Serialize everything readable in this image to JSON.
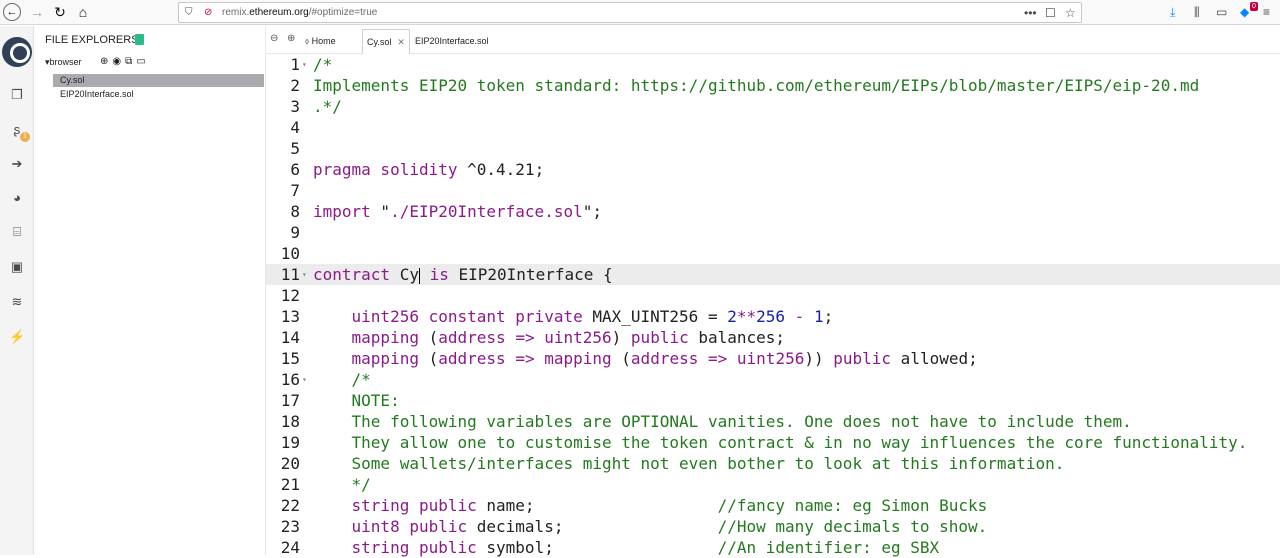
{
  "browser": {
    "url_prefix": "remix.",
    "url_domain": "ethereum.org",
    "url_suffix": "/#optimize=true",
    "menu_dots": "•••",
    "ext_badge": "0"
  },
  "file_explorer": {
    "title": "FILE EXPLORERS",
    "root": "browser",
    "files": [
      {
        "name": "Cy.sol",
        "active": true
      },
      {
        "name": "EIP20Interface.sol",
        "active": false
      }
    ]
  },
  "tabs": {
    "home": "Home",
    "items": [
      {
        "label": "Cy.sol",
        "active": true
      },
      {
        "label": "EIP20Interface.sol",
        "active": false
      }
    ]
  },
  "icon_panel": {
    "badge_count": "1"
  },
  "editor": {
    "highlighted_line": 11,
    "lines": [
      {
        "n": "1",
        "fold": true,
        "tokens": [
          [
            "comment",
            "/*"
          ]
        ]
      },
      {
        "n": "2",
        "fold": false,
        "tokens": [
          [
            "comment",
            "Implements EIP20 token standard: https://github.com/ethereum/EIPs/blob/master/EIPS/eip-20.md"
          ]
        ]
      },
      {
        "n": "3",
        "fold": false,
        "tokens": [
          [
            "comment",
            ".*/"
          ]
        ]
      },
      {
        "n": "4",
        "fold": false,
        "tokens": []
      },
      {
        "n": "5",
        "fold": false,
        "tokens": []
      },
      {
        "n": "6",
        "fold": false,
        "tokens": [
          [
            "kw",
            "pragma solidity"
          ],
          [
            "plain",
            " ^0.4.21;"
          ]
        ]
      },
      {
        "n": "7",
        "fold": false,
        "tokens": []
      },
      {
        "n": "8",
        "fold": false,
        "tokens": [
          [
            "kw",
            "import"
          ],
          [
            "plain",
            " \""
          ],
          [
            "kw",
            "./EIP20Interface.sol"
          ],
          [
            "plain",
            "\";"
          ]
        ]
      },
      {
        "n": "9",
        "fold": false,
        "tokens": []
      },
      {
        "n": "10",
        "fold": false,
        "tokens": []
      },
      {
        "n": "11",
        "fold": true,
        "tokens": [
          [
            "kw",
            "contract"
          ],
          [
            "plain",
            " Cy"
          ],
          [
            "cursor",
            ""
          ],
          [
            "plain",
            " "
          ],
          [
            "kw",
            "is"
          ],
          [
            "plain",
            " EIP20Interface {"
          ]
        ]
      },
      {
        "n": "12",
        "fold": false,
        "tokens": []
      },
      {
        "n": "13",
        "fold": false,
        "tokens": [
          [
            "plain",
            "    "
          ],
          [
            "kw",
            "uint256 constant private"
          ],
          [
            "plain",
            " MAX_UINT256 = "
          ],
          [
            "num",
            "2"
          ],
          [
            "op",
            "**"
          ],
          [
            "num",
            "256"
          ],
          [
            "plain",
            " "
          ],
          [
            "op",
            "-"
          ],
          [
            "plain",
            " "
          ],
          [
            "num",
            "1"
          ],
          [
            "plain",
            ";"
          ]
        ]
      },
      {
        "n": "14",
        "fold": false,
        "tokens": [
          [
            "plain",
            "    "
          ],
          [
            "kw",
            "mapping"
          ],
          [
            "plain",
            " ("
          ],
          [
            "kw",
            "address"
          ],
          [
            "plain",
            " "
          ],
          [
            "op",
            "=>"
          ],
          [
            "plain",
            " "
          ],
          [
            "kw",
            "uint256"
          ],
          [
            "plain",
            ") "
          ],
          [
            "kw",
            "public"
          ],
          [
            "plain",
            " balances;"
          ]
        ]
      },
      {
        "n": "15",
        "fold": false,
        "tokens": [
          [
            "plain",
            "    "
          ],
          [
            "kw",
            "mapping"
          ],
          [
            "plain",
            " ("
          ],
          [
            "kw",
            "address"
          ],
          [
            "plain",
            " "
          ],
          [
            "op",
            "=>"
          ],
          [
            "plain",
            " "
          ],
          [
            "kw",
            "mapping"
          ],
          [
            "plain",
            " ("
          ],
          [
            "kw",
            "address"
          ],
          [
            "plain",
            " "
          ],
          [
            "op",
            "=>"
          ],
          [
            "plain",
            " "
          ],
          [
            "kw",
            "uint256"
          ],
          [
            "plain",
            ")) "
          ],
          [
            "kw",
            "public"
          ],
          [
            "plain",
            " allowed;"
          ]
        ]
      },
      {
        "n": "16",
        "fold": true,
        "tokens": [
          [
            "plain",
            "    "
          ],
          [
            "comment",
            "/*"
          ]
        ]
      },
      {
        "n": "17",
        "fold": false,
        "tokens": [
          [
            "plain",
            "    "
          ],
          [
            "comment",
            "NOTE:"
          ]
        ]
      },
      {
        "n": "18",
        "fold": false,
        "tokens": [
          [
            "plain",
            "    "
          ],
          [
            "comment",
            "The following variables are OPTIONAL vanities. One does not have to include them."
          ]
        ]
      },
      {
        "n": "19",
        "fold": false,
        "tokens": [
          [
            "plain",
            "    "
          ],
          [
            "comment",
            "They allow one to customise the token contract & in no way influences the core functionality."
          ]
        ]
      },
      {
        "n": "20",
        "fold": false,
        "tokens": [
          [
            "plain",
            "    "
          ],
          [
            "comment",
            "Some wallets/interfaces might not even bother to look at this information."
          ]
        ]
      },
      {
        "n": "21",
        "fold": false,
        "tokens": [
          [
            "plain",
            "    "
          ],
          [
            "comment",
            "*/"
          ]
        ]
      },
      {
        "n": "22",
        "fold": false,
        "tokens": [
          [
            "plain",
            "    "
          ],
          [
            "kw",
            "string public"
          ],
          [
            "plain",
            " name;                   "
          ],
          [
            "comment",
            "//fancy name: eg Simon Bucks"
          ]
        ]
      },
      {
        "n": "23",
        "fold": false,
        "tokens": [
          [
            "plain",
            "    "
          ],
          [
            "kw",
            "uint8 public"
          ],
          [
            "plain",
            " decimals;                "
          ],
          [
            "comment",
            "//How many decimals to show."
          ]
        ]
      },
      {
        "n": "24",
        "fold": false,
        "tokens": [
          [
            "plain",
            "    "
          ],
          [
            "kw",
            "string public"
          ],
          [
            "plain",
            " symbol;                 "
          ],
          [
            "comment",
            "//An identifier: eg SBX"
          ]
        ]
      }
    ]
  }
}
